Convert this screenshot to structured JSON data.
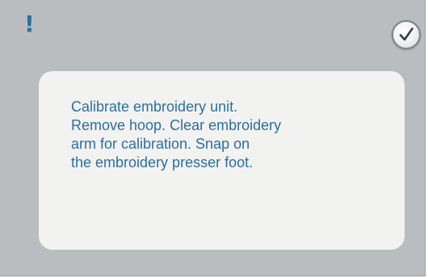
{
  "dialog": {
    "alert_symbol": "!",
    "ok_icon": "checkmark-icon",
    "message_lines": [
      "Calibrate embroidery unit.",
      "Remove hoop. Clear embroidery",
      "arm for calibration. Snap on",
      "the embroidery presser foot."
    ]
  },
  "colors": {
    "background": "#b9bdc0",
    "panel": "#f2f2f1",
    "text": "#2c6f9f"
  }
}
